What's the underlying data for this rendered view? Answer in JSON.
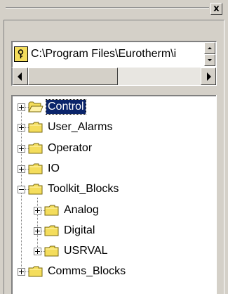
{
  "titlebar": {
    "close_label": "x"
  },
  "path": {
    "value": "C:\\Program Files\\Eurotherm\\i",
    "icon": "folder-key-icon"
  },
  "tree": {
    "nodes": [
      {
        "label": "Control",
        "level": 0,
        "expander": "plus",
        "selected": true,
        "icon": "open-folder-icon"
      },
      {
        "label": "User_Alarms",
        "level": 0,
        "expander": "plus",
        "icon": "folder-icon"
      },
      {
        "label": "Operator",
        "level": 0,
        "expander": "plus",
        "icon": "folder-icon"
      },
      {
        "label": "IO",
        "level": 0,
        "expander": "plus",
        "icon": "folder-icon"
      },
      {
        "label": "Toolkit_Blocks",
        "level": 0,
        "expander": "minus",
        "icon": "folder-icon"
      },
      {
        "label": "Analog",
        "level": 1,
        "expander": "plus",
        "icon": "folder-icon"
      },
      {
        "label": "Digital",
        "level": 1,
        "expander": "plus",
        "icon": "folder-icon"
      },
      {
        "label": "USRVAL",
        "level": 1,
        "expander": "plus",
        "icon": "folder-icon"
      },
      {
        "label": "Comms_Blocks",
        "level": 0,
        "expander": "plus",
        "icon": "folder-icon"
      }
    ]
  },
  "colors": {
    "chrome": "#d4d0c8",
    "selection": "#0a246a",
    "folder": "#f4dd5c"
  }
}
